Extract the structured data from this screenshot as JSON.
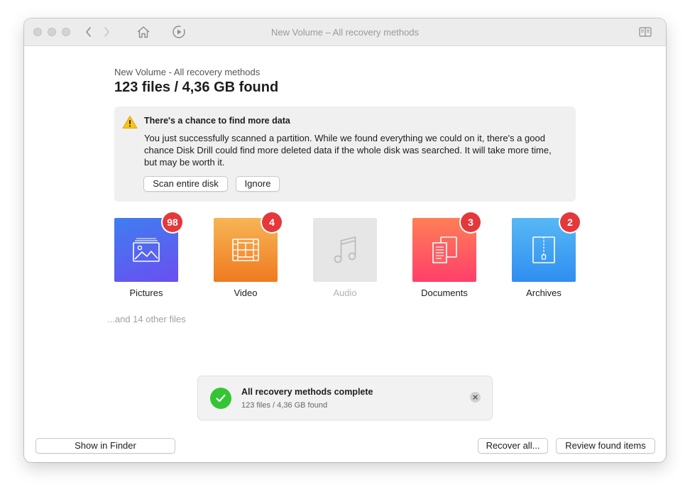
{
  "window": {
    "title": "New Volume – All recovery methods"
  },
  "toolbar": {
    "icons": [
      "back-arrow-icon",
      "forward-arrow-icon",
      "home-icon",
      "recovery-play-icon",
      "sidebar-toggle-icon"
    ]
  },
  "header": {
    "subtitle": "New Volume - All recovery methods",
    "summary": "123 files / 4,36 GB found"
  },
  "notice": {
    "icon": "warning-icon",
    "title": "There's a chance to find more data",
    "body": "You just successfully scanned a partition. While we found everything we could on it, there's a good chance Disk Drill could find more deleted data if the whole disk was searched. It will take more time, but may be worth it.",
    "scan_button": "Scan entire disk",
    "ignore_button": "Ignore"
  },
  "categories": [
    {
      "label": "Pictures",
      "count": "98",
      "icon": "picture-icon",
      "color_from": "#3f7ef0",
      "color_to": "#6a4ff0"
    },
    {
      "label": "Video",
      "count": "4",
      "icon": "film-icon",
      "color_from": "#f7b555",
      "color_to": "#f07a20"
    },
    {
      "label": "Audio",
      "count": "",
      "icon": "music-note-icon",
      "color_from": "#e6e6e6",
      "color_to": "#e6e6e6"
    },
    {
      "label": "Documents",
      "count": "3",
      "icon": "documents-icon",
      "color_from": "#ff7f56",
      "color_to": "#ff3f6a"
    },
    {
      "label": "Archives",
      "count": "2",
      "icon": "archive-zip-icon",
      "color_from": "#58b8f5",
      "color_to": "#2f8ef0"
    }
  ],
  "other_files": "...and 14 other files",
  "toast": {
    "title": "All recovery methods complete",
    "subtitle": "123 files / 4,36 GB found"
  },
  "footer": {
    "show_in_finder": "Show in Finder",
    "recover_all": "Recover all...",
    "review": "Review found items"
  },
  "colors": {
    "badge": "#e5383b",
    "success": "#34c534",
    "warning": "#f5c518"
  }
}
